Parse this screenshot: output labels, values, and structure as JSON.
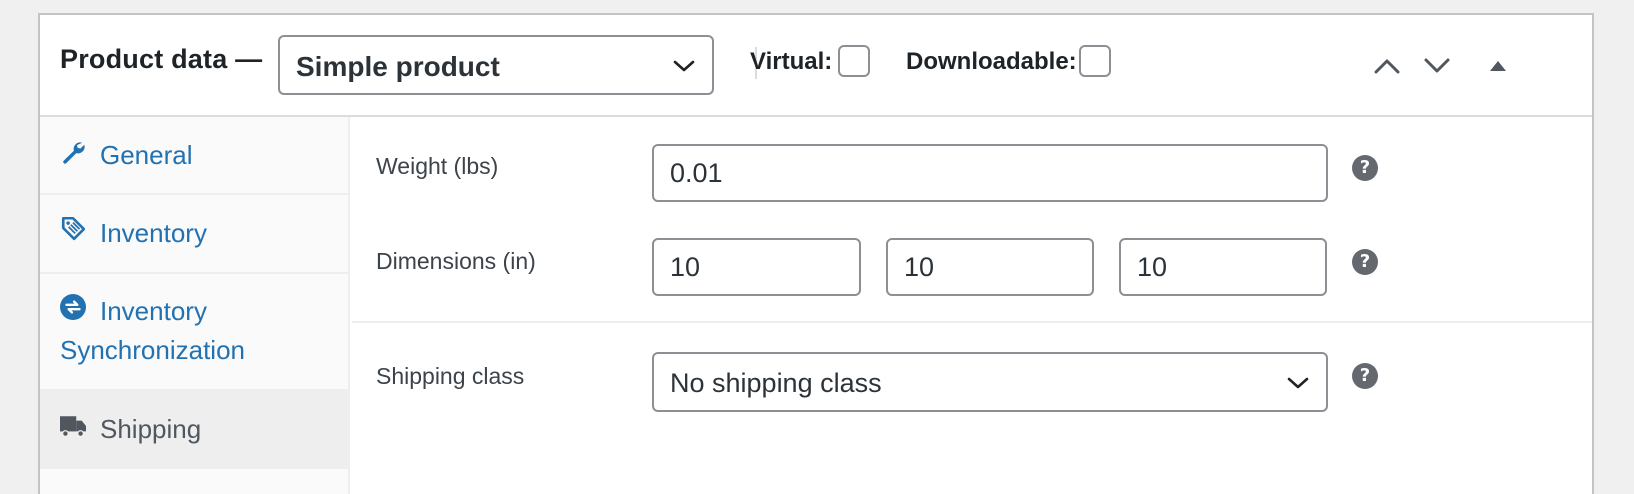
{
  "header": {
    "title": "Product data —",
    "product_type": {
      "selected": "Simple product"
    },
    "virtual_label": "Virtual:",
    "downloadable_label": "Downloadable:",
    "virtual_checked": false,
    "downloadable_checked": false
  },
  "tabs": [
    {
      "label": "General",
      "icon": "wrench-icon",
      "active": false
    },
    {
      "label": "Inventory",
      "icon": "tag-icon",
      "active": false
    },
    {
      "label_line1": "Inventory",
      "label_line2": "Synchronization",
      "icon": "sync-icon",
      "active": false
    },
    {
      "label": "Shipping",
      "icon": "truck-icon",
      "active": true
    }
  ],
  "shipping": {
    "weight_label": "Weight (lbs)",
    "weight_value": "0.01",
    "dimensions_label": "Dimensions (in)",
    "length_value": "10",
    "width_value": "10",
    "height_value": "10",
    "shipping_class_label": "Shipping class",
    "shipping_class_selected": "No shipping class",
    "help_glyph": "?"
  },
  "colors": {
    "link": "#2271b1",
    "active_tab_text": "#50575e",
    "border": "#8c8f94"
  }
}
